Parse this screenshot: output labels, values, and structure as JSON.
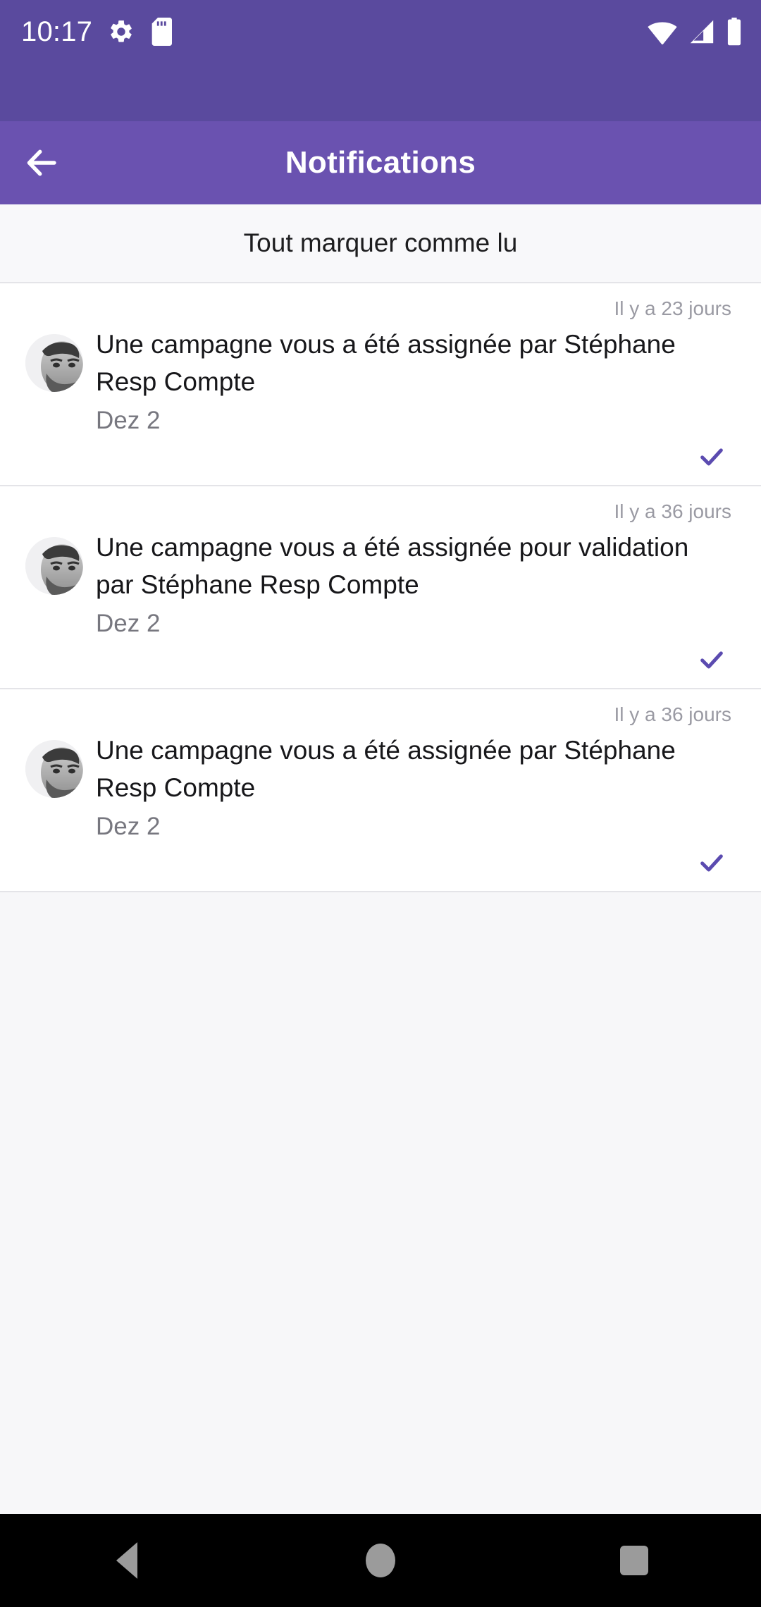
{
  "status_bar": {
    "clock": "10:17",
    "left_icons": [
      "gear-icon",
      "sd-card-icon"
    ],
    "right_icons": [
      "wifi-icon",
      "cellular-signal-icon",
      "battery-icon"
    ],
    "background_color": "#5a4a9e"
  },
  "app_bar": {
    "title": "Notifications",
    "back_icon": "arrow-left-icon",
    "background_color": "#6a52b0"
  },
  "mark_all": {
    "label": "Tout marquer comme lu"
  },
  "notifications": [
    {
      "time": "Il y a 23 jours",
      "message": "Une campagne vous a été assignée par Stéphane Resp Compte",
      "subtitle": "Dez 2",
      "check_icon": "check-icon",
      "check_color": "#5b4bb0",
      "avatar": "user-avatar"
    },
    {
      "time": "Il y a 36 jours",
      "message": "Une campagne vous a été assignée pour validation par Stéphane Resp Compte",
      "subtitle": "Dez 2",
      "check_icon": "check-icon",
      "check_color": "#5b4bb0",
      "avatar": "user-avatar"
    },
    {
      "time": "Il y a 36 jours",
      "message": "Une campagne vous a été assignée par Stéphane Resp Compte",
      "subtitle": "Dez 2",
      "check_icon": "check-icon",
      "check_color": "#5b4bb0",
      "avatar": "user-avatar"
    }
  ],
  "nav_bar": {
    "back_label": "back-triangle-icon",
    "home_label": "home-circle-icon",
    "recents_label": "recents-square-icon"
  }
}
